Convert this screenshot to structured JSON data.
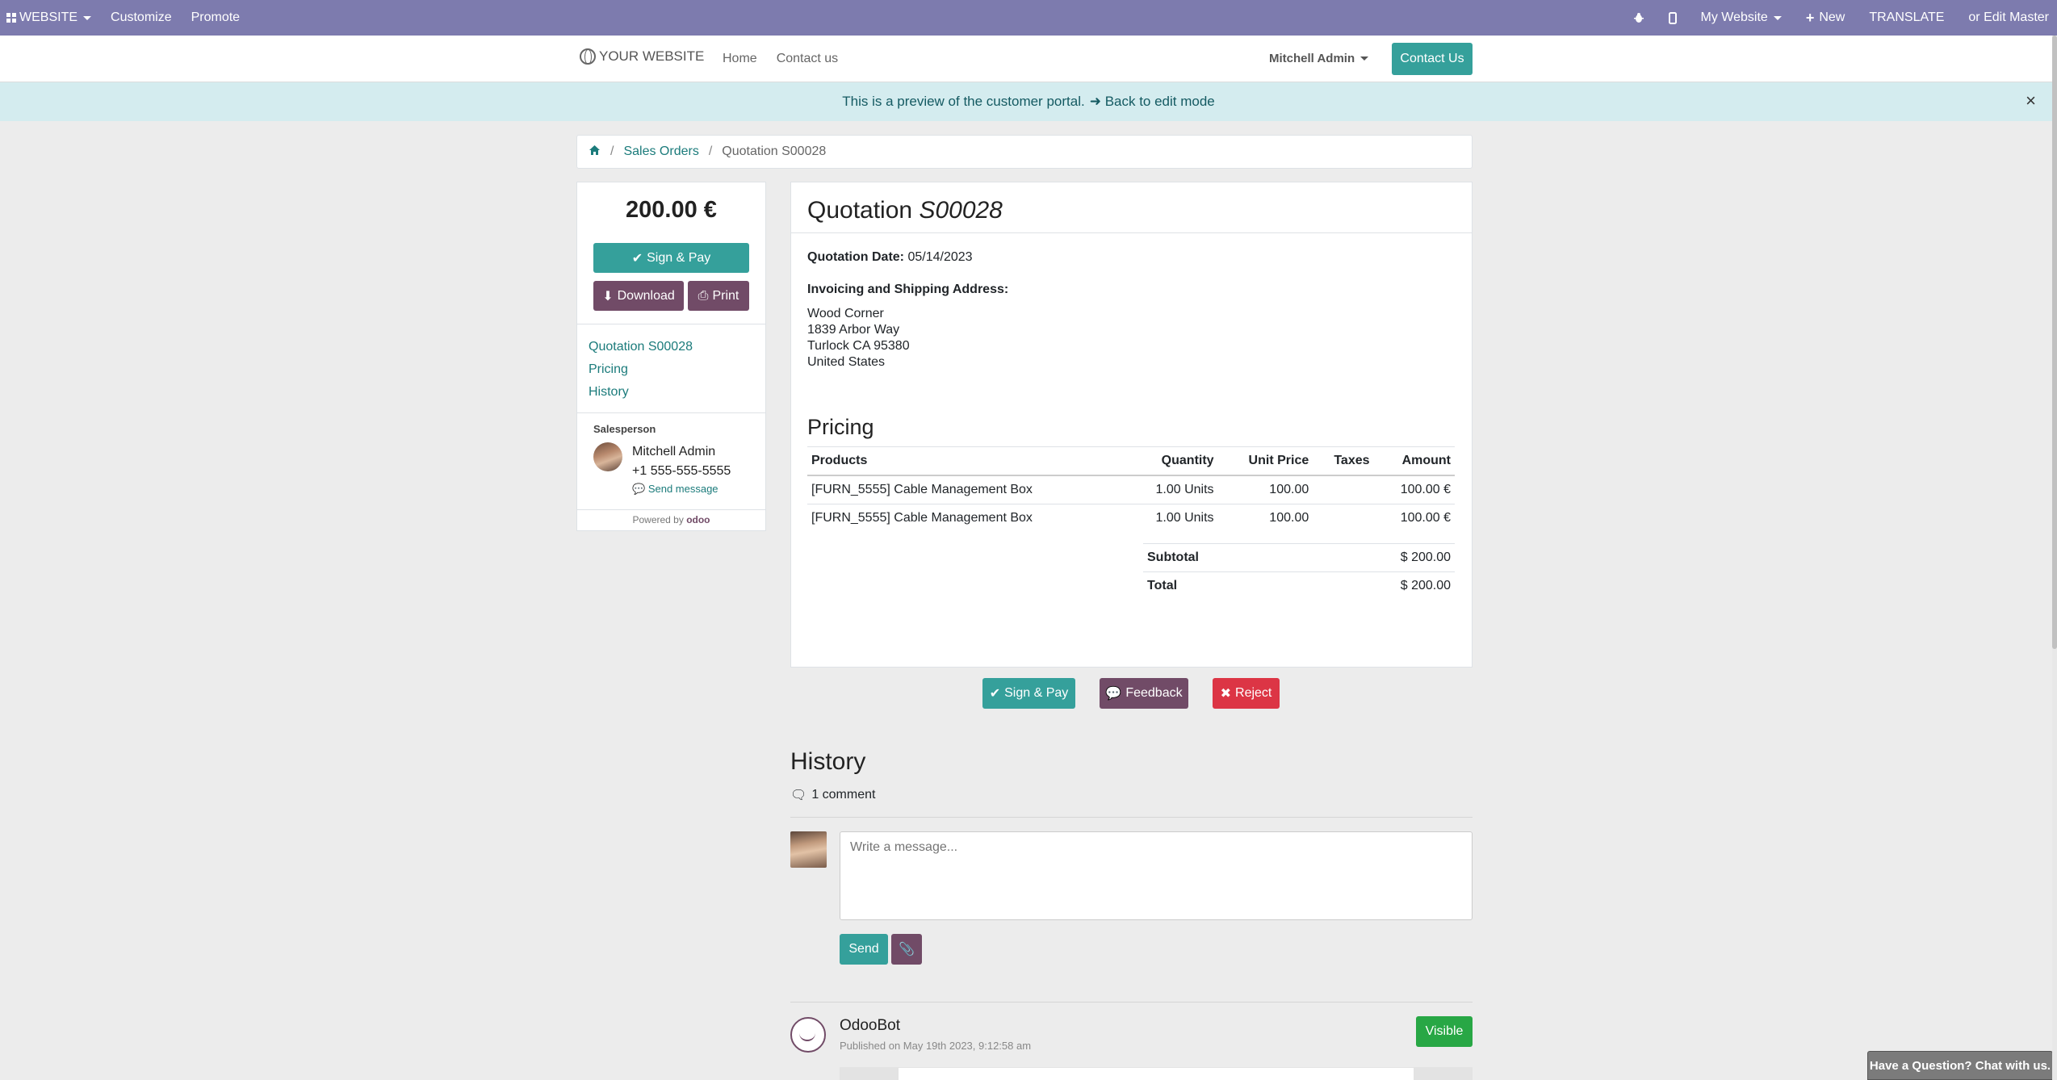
{
  "adminbar": {
    "website_menu": "WEBSITE",
    "customize": "Customize",
    "promote": "Promote",
    "site_selector": "My Website",
    "new": "New",
    "translate": "TRANSLATE",
    "edit": "or Edit Master"
  },
  "header": {
    "logo": "YOUR WEBSITE",
    "nav": [
      "Home",
      "Contact us"
    ],
    "user": "Mitchell Admin",
    "contact_button": "Contact Us"
  },
  "banner": {
    "text": "This is a preview of the customer portal.",
    "link": "Back to edit mode"
  },
  "breadcrumb": {
    "home_icon": "home-icon",
    "items": [
      "Sales Orders",
      "Quotation S00028"
    ]
  },
  "sidebar": {
    "amount": "200.00 €",
    "sign_pay": "Sign & Pay",
    "download": "Download",
    "print": "Print",
    "links": [
      "Quotation S00028",
      "Pricing",
      "History"
    ],
    "salesperson_label": "Salesperson",
    "salesperson_name": "Mitchell Admin",
    "salesperson_phone": "+1 555-555-5555",
    "send_message": "Send message",
    "powered_by": "Powered by",
    "powered_brand": "odoo"
  },
  "quotation": {
    "title_prefix": "Quotation",
    "number": "S00028",
    "date_label": "Quotation Date:",
    "date": "05/14/2023",
    "address_label": "Invoicing and Shipping Address:",
    "address": [
      "Wood Corner",
      "1839 Arbor Way",
      "Turlock CA 95380",
      "United States"
    ],
    "pricing_heading": "Pricing",
    "columns": [
      "Products",
      "Quantity",
      "Unit Price",
      "Taxes",
      "Amount"
    ],
    "lines": [
      {
        "product": "[FURN_5555] Cable Management Box",
        "quantity": "1.00 Units",
        "unit_price": "100.00",
        "taxes": "",
        "amount": "100.00 €"
      },
      {
        "product": "[FURN_5555] Cable Management Box",
        "quantity": "1.00 Units",
        "unit_price": "100.00",
        "taxes": "",
        "amount": "100.00 €"
      }
    ],
    "subtotal_label": "Subtotal",
    "subtotal": "$ 200.00",
    "total_label": "Total",
    "total": "$ 200.00"
  },
  "actions": {
    "sign_pay": "Sign & Pay",
    "feedback": "Feedback",
    "reject": "Reject"
  },
  "history": {
    "heading": "History",
    "comments": "1 comment",
    "placeholder": "Write a message...",
    "send": "Send",
    "message": {
      "author": "OdooBot",
      "published": "Published on May 19th 2023, 9:12:58 am",
      "visibility": "Visible"
    }
  },
  "chat_widget": "Have a Question? Chat with us.",
  "colors": {
    "adminbar": "#7d7bae",
    "teal": "#35a09b",
    "purple": "#714b67",
    "red": "#dc3545",
    "green": "#28a745"
  }
}
